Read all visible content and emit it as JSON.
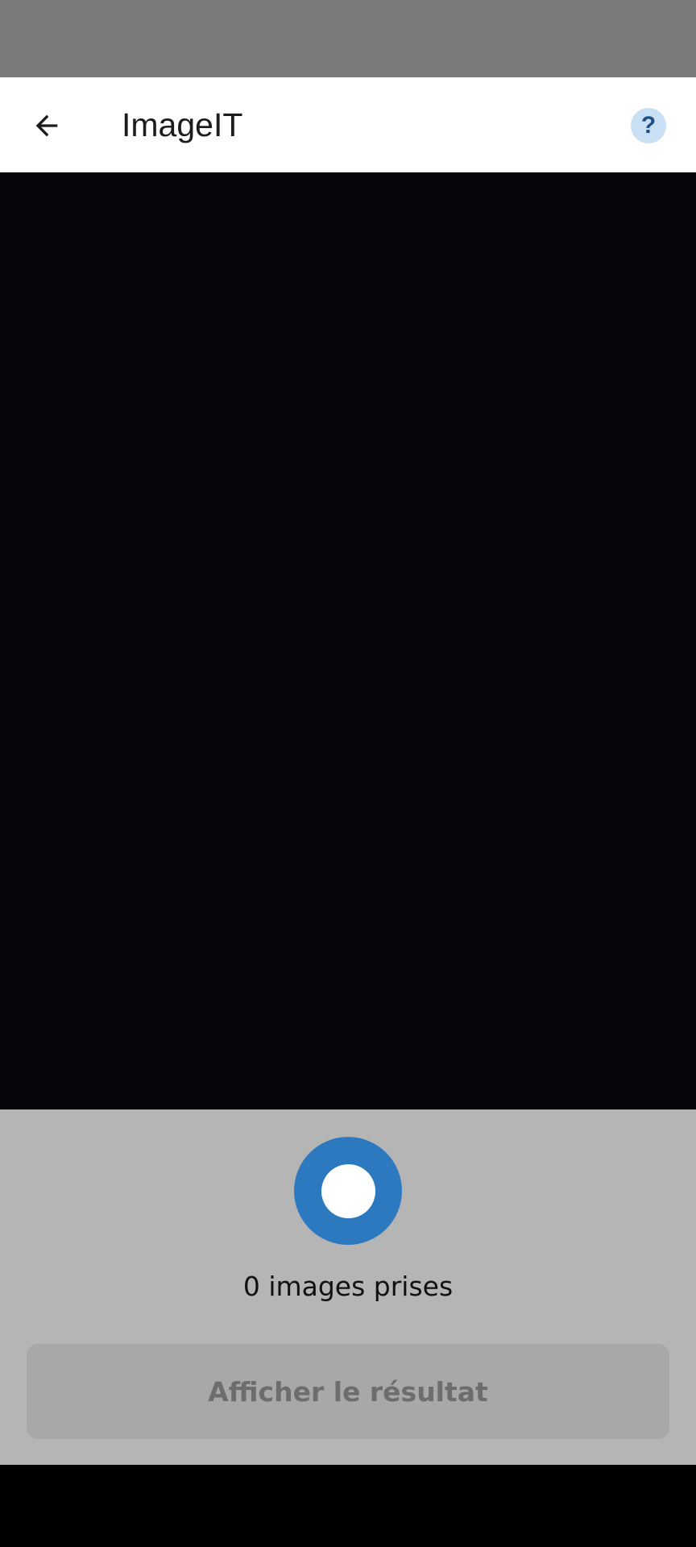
{
  "app_bar": {
    "title": "ImageIT",
    "back_icon": "arrow-left-icon",
    "help_icon": "help-icon",
    "help_label": "?"
  },
  "camera": {
    "shutter_icon": "shutter-icon"
  },
  "bottom_panel": {
    "image_count_text": "0 images prises",
    "result_button_label": "Afficher le résultat"
  },
  "colors": {
    "status_bar": "#7b7b7b",
    "preview_background": "#07050b",
    "panel_background": "#b5b5b5",
    "shutter_accent": "#2c79c0",
    "help_background": "#c9dff3",
    "help_glyph": "#1e4f86",
    "disabled_button": "#a8a8a8"
  }
}
